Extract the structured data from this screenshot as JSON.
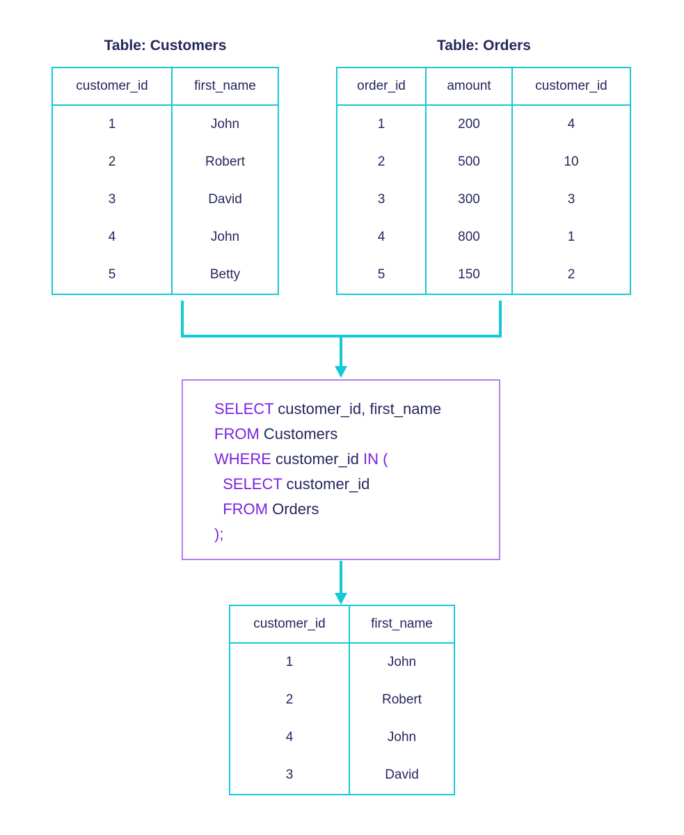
{
  "customers": {
    "title": "Table: Customers",
    "headers": [
      "customer_id",
      "first_name"
    ],
    "rows": [
      [
        "1",
        "John"
      ],
      [
        "2",
        "Robert"
      ],
      [
        "3",
        "David"
      ],
      [
        "4",
        "John"
      ],
      [
        "5",
        "Betty"
      ]
    ]
  },
  "orders": {
    "title": "Table: Orders",
    "headers": [
      "order_id",
      "amount",
      "customer_id"
    ],
    "rows": [
      [
        "1",
        "200",
        "4"
      ],
      [
        "2",
        "500",
        "10"
      ],
      [
        "3",
        "300",
        "3"
      ],
      [
        "4",
        "800",
        "1"
      ],
      [
        "5",
        "150",
        "2"
      ]
    ]
  },
  "query": {
    "lines": [
      {
        "kw": "SELECT",
        "rest": " customer_id, first_name"
      },
      {
        "kw": "FROM",
        "rest": " Customers"
      },
      {
        "kw": "WHERE",
        "rest": " customer_id ",
        "kw2": "IN (",
        "rest2": ""
      },
      {
        "kw": "  SELECT",
        "rest": " customer_id"
      },
      {
        "kw": "  FROM",
        "rest": " Orders"
      },
      {
        "kw": ");",
        "rest": ""
      }
    ]
  },
  "result": {
    "headers": [
      "customer_id",
      "first_name"
    ],
    "rows": [
      [
        "1",
        "John"
      ],
      [
        "2",
        "Robert"
      ],
      [
        "4",
        "John"
      ],
      [
        "3",
        "David"
      ]
    ]
  },
  "colors": {
    "table_border": "#14c9d6",
    "query_border": "#b57cf2",
    "keyword": "#7b23e0",
    "text": "#25265e"
  }
}
